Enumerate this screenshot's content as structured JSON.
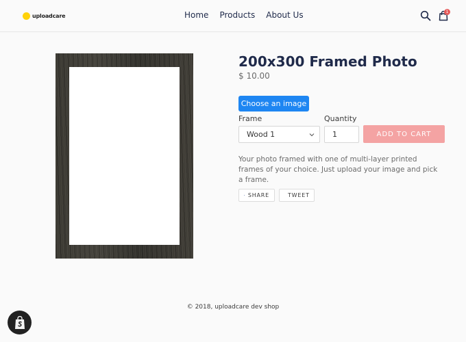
{
  "header": {
    "logo_text": "uploadcare",
    "nav": [
      {
        "label": "Home"
      },
      {
        "label": "Products"
      },
      {
        "label": "About Us"
      }
    ],
    "cart_count": "1"
  },
  "product": {
    "title": "200x300 Framed Photo",
    "price": "$ 10.00",
    "choose_image_label": "Choose an image",
    "frame_label": "Frame",
    "frame_selected": "Wood 1",
    "quantity_label": "Quantity",
    "quantity_value": "1",
    "add_to_cart_label": "ADD TO CART",
    "description": "Your photo framed with one of multi-layer printed frames of your choice. Just upload your image and pick a frame.",
    "share_label": "SHARE",
    "tweet_label": "TWEET"
  },
  "footer": {
    "copyright": "© 2018, uploadcare dev shop"
  },
  "colors": {
    "accent_blue": "#1e86f2",
    "add_to_cart_bg": "#f4a3a3",
    "logo_yellow": "#ffd20a",
    "nav_text": "#1f2a4a",
    "cart_badge": "#e55b5b"
  }
}
